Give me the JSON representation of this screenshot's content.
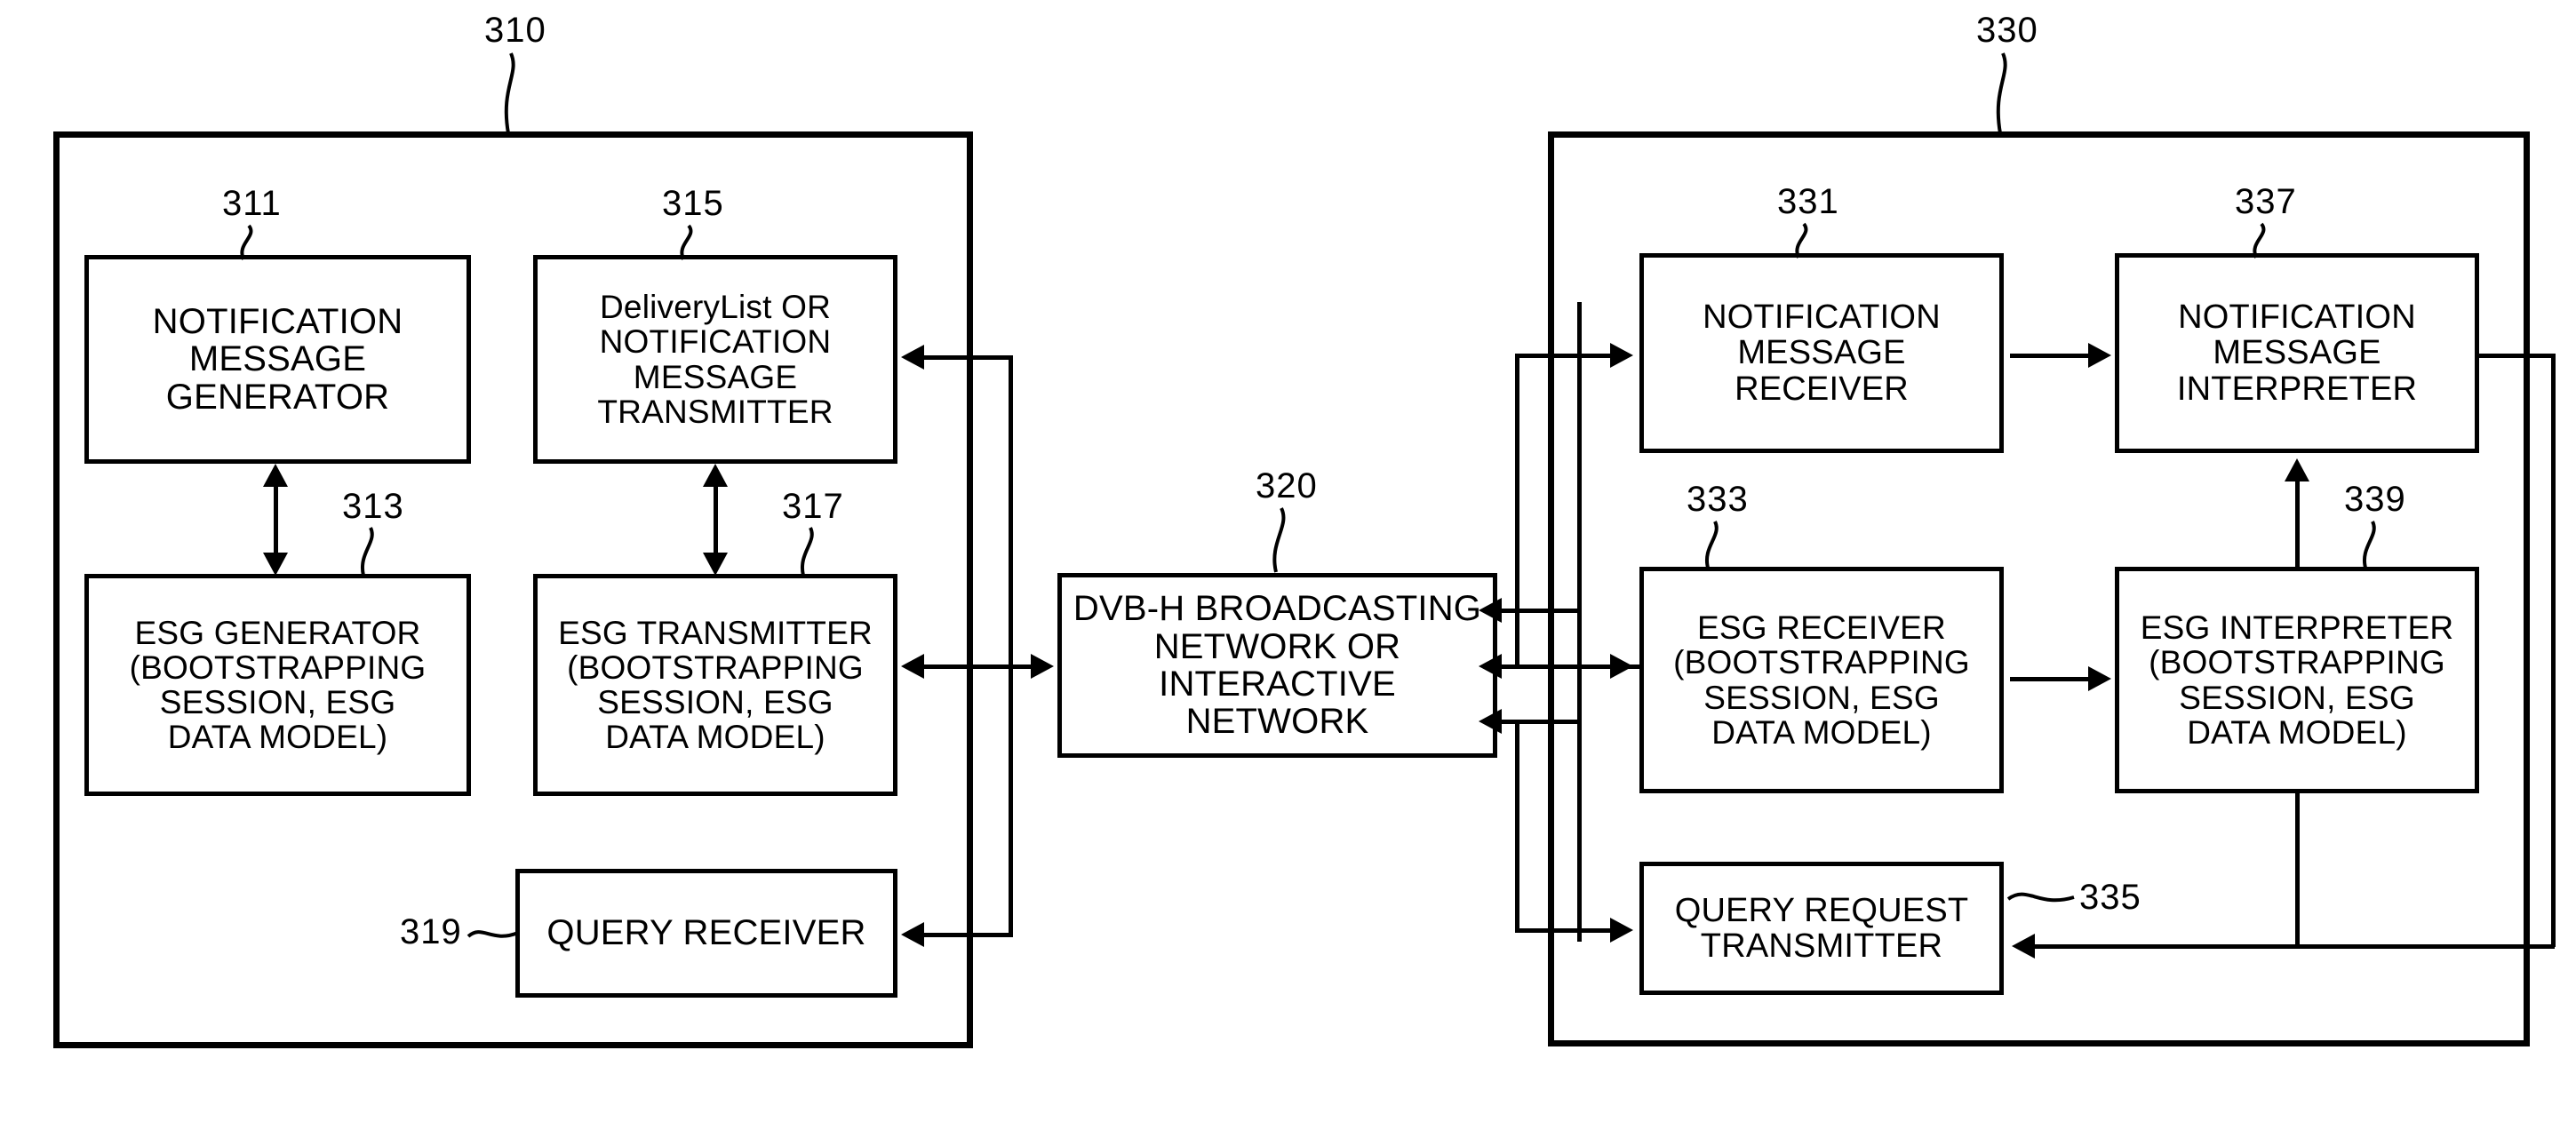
{
  "figure": {
    "type": "patent-block-diagram",
    "title": "ESG / Notification message transmission system over DVB-H"
  },
  "systems": [
    {
      "id": "310",
      "ref": "310",
      "name": "transmitter-system"
    },
    {
      "id": "320",
      "ref": "320",
      "name": "network-system"
    },
    {
      "id": "330",
      "ref": "330",
      "name": "receiver-system"
    }
  ],
  "blocks": {
    "b311": {
      "ref": "311",
      "lines": [
        "NOTIFICATION",
        "MESSAGE",
        "GENERATOR"
      ]
    },
    "b315": {
      "ref": "315",
      "lines": [
        "DeliveryList OR",
        "NOTIFICATION",
        "MESSAGE",
        "TRANSMITTER"
      ]
    },
    "b313": {
      "ref": "313",
      "lines": [
        "ESG GENERATOR",
        "(BOOTSTRAPPING",
        "SESSION, ESG",
        "DATA MODEL)"
      ]
    },
    "b317": {
      "ref": "317",
      "lines": [
        "ESG TRANSMITTER",
        "(BOOTSTRAPPING",
        "SESSION, ESG",
        "DATA MODEL)"
      ]
    },
    "b319": {
      "ref": "319",
      "lines": [
        "QUERY RECEIVER"
      ]
    },
    "b320": {
      "ref": "320",
      "lines": [
        "DVB-H BROADCASTING",
        "NETWORK OR",
        "INTERACTIVE NETWORK"
      ]
    },
    "b331": {
      "ref": "331",
      "lines": [
        "NOTIFICATION",
        "MESSAGE",
        "RECEIVER"
      ]
    },
    "b337": {
      "ref": "337",
      "lines": [
        "NOTIFICATION",
        "MESSAGE",
        "INTERPRETER"
      ]
    },
    "b333": {
      "ref": "333",
      "lines": [
        "ESG RECEIVER",
        "(BOOTSTRAPPING",
        "SESSION, ESG",
        "DATA MODEL)"
      ]
    },
    "b339": {
      "ref": "339",
      "lines": [
        "ESG INTERPRETER",
        "(BOOTSTRAPPING",
        "SESSION, ESG",
        "DATA MODEL)"
      ]
    },
    "b335": {
      "ref": "335",
      "lines": [
        "QUERY REQUEST",
        "TRANSMITTER"
      ]
    }
  },
  "colors": {
    "ink": "#000000",
    "paper": "#ffffff"
  }
}
